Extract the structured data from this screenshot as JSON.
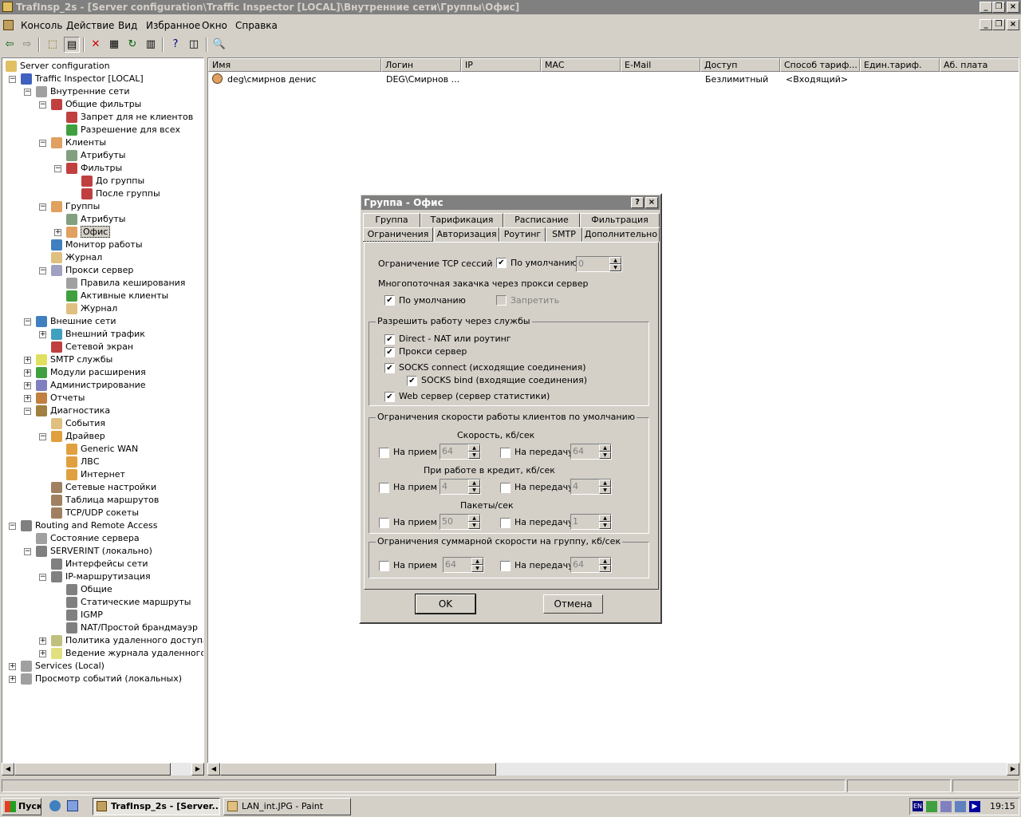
{
  "window": {
    "title": "TrafInsp_2s - [Server configuration\\Traffic Inspector [LOCAL]\\Внутренние сети\\Группы\\Офис]"
  },
  "menu": [
    "Консоль",
    "Действие",
    "Вид",
    "Избранное",
    "Окно",
    "Справка"
  ],
  "toolbar_icons": [
    "back-icon",
    "forward-icon",
    "up-folder-icon",
    "show-tree-icon",
    "delete-icon",
    "properties-icon",
    "refresh-icon",
    "export-icon",
    "help-icon",
    "new-window-icon",
    "search-icon"
  ],
  "tree": [
    {
      "label": "Server configuration",
      "depth": 0
    },
    {
      "label": "Traffic Inspector [LOCAL]",
      "depth": 1
    },
    {
      "label": "Внутренние сети",
      "depth": 2
    },
    {
      "label": "Общие фильтры",
      "depth": 3
    },
    {
      "label": "Запрет для не клиентов",
      "depth": 4
    },
    {
      "label": "Разрешение для всех",
      "depth": 4
    },
    {
      "label": "Клиенты",
      "depth": 3
    },
    {
      "label": "Атрибуты",
      "depth": 4
    },
    {
      "label": "Фильтры",
      "depth": 4
    },
    {
      "label": "До группы",
      "depth": 5
    },
    {
      "label": "После группы",
      "depth": 5
    },
    {
      "label": "Группы",
      "depth": 3
    },
    {
      "label": "Атрибуты",
      "depth": 4
    },
    {
      "label": "Офис",
      "depth": 4
    },
    {
      "label": "Монитор работы",
      "depth": 3
    },
    {
      "label": "Журнал",
      "depth": 3
    },
    {
      "label": "Прокси сервер",
      "depth": 3
    },
    {
      "label": "Правила кеширования",
      "depth": 4
    },
    {
      "label": "Активные клиенты",
      "depth": 4
    },
    {
      "label": "Журнал",
      "depth": 4
    },
    {
      "label": "Внешние сети",
      "depth": 2
    },
    {
      "label": "Внешний трафик",
      "depth": 3
    },
    {
      "label": "Сетевой экран",
      "depth": 3
    },
    {
      "label": "SMTP службы",
      "depth": 2
    },
    {
      "label": "Модули расширения",
      "depth": 2
    },
    {
      "label": "Администрирование",
      "depth": 2
    },
    {
      "label": "Отчеты",
      "depth": 2
    },
    {
      "label": "Диагностика",
      "depth": 2
    },
    {
      "label": "События",
      "depth": 3
    },
    {
      "label": "Драйвер",
      "depth": 3
    },
    {
      "label": "Generic WAN",
      "depth": 4
    },
    {
      "label": "ЛВС",
      "depth": 4
    },
    {
      "label": "Интернет",
      "depth": 4
    },
    {
      "label": "Сетевые настройки",
      "depth": 3
    },
    {
      "label": "Таблица маршрутов",
      "depth": 3
    },
    {
      "label": "TCP/UDP сокеты",
      "depth": 3
    },
    {
      "label": "Routing and Remote Access",
      "depth": 1
    },
    {
      "label": "Состояние сервера",
      "depth": 2
    },
    {
      "label": "SERVERINT (локально)",
      "depth": 2
    },
    {
      "label": "Интерфейсы сети",
      "depth": 3
    },
    {
      "label": "IP-маршрутизация",
      "depth": 3
    },
    {
      "label": "Общие",
      "depth": 4
    },
    {
      "label": "Статические маршруты",
      "depth": 4
    },
    {
      "label": "IGMP",
      "depth": 4
    },
    {
      "label": "NAT/Простой брандмауэр",
      "depth": 4
    },
    {
      "label": "Политика удаленного доступа",
      "depth": 3
    },
    {
      "label": "Ведение журнала удаленного дос",
      "depth": 3
    },
    {
      "label": "Services (Local)",
      "depth": 1
    },
    {
      "label": "Просмотр событий (локальных)",
      "depth": 1
    }
  ],
  "list": {
    "columns": [
      "Имя",
      "Логин",
      "IP",
      "MAC",
      "E-Mail",
      "Доступ",
      "Способ тариф...",
      "Един.тариф.",
      "Аб. плата"
    ],
    "rows": [
      [
        "deg\\смирнов денис",
        "DEG\\Смирнов ...",
        "",
        "",
        "",
        "Безлимитный",
        "<Входящий>",
        "",
        ""
      ]
    ]
  },
  "dialog": {
    "title": "Группа - Офис",
    "tabs_row1": [
      "Группа",
      "Тарификация",
      "Расписание",
      "Фильтрация"
    ],
    "tabs_row2": [
      "Ограничения",
      "Авторизация",
      "Роутинг",
      "SMTP",
      "Дополнительно"
    ],
    "tcp_label": "Ограничение TCP сессий",
    "default_label": "По умолчанию",
    "tcp_value": "0",
    "multi_label": "Многопоточная закачка через прокси сервер",
    "multi_default_label": "По умолчанию",
    "deny_label": "Запретить",
    "services_title": "Разрешить работу через службы",
    "services": [
      "Direct - NAT или роутинг",
      "Прокси сервер",
      "SOCKS connect (исходящие соединения)",
      "SOCKS bind (входящие соединения)",
      "Web сервер (сервер статистики)"
    ],
    "speed_title": "Ограничения скорости работы клиентов по умолчанию",
    "speed_label": "Скорость, кб/сек",
    "credit_label": "При работе в кредит, кб/сек",
    "packets_label": "Пакеты/сек",
    "recv_label": "На прием",
    "send_label": "На передачу",
    "speed_recv": "64",
    "speed_send": "64",
    "credit_recv": "4",
    "credit_send": "4",
    "packets_recv": "50",
    "packets_send": "1",
    "group_title": "Ограничения суммарной скорости на группу, кб/сек",
    "group_recv": "64",
    "group_send": "64",
    "ok": "OK",
    "cancel": "Отмена"
  },
  "taskbar": {
    "start": "Пуск",
    "tasks": [
      "TrafInsp_2s - [Server...",
      "LAN_int.JPG - Paint"
    ],
    "lang": "EN",
    "clock": "19:15"
  }
}
